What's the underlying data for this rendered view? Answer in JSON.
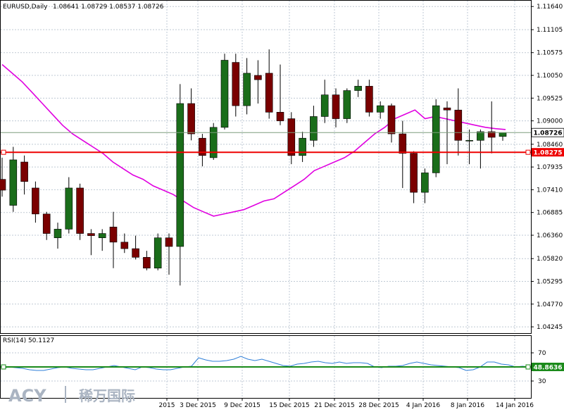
{
  "header": {
    "symbol": "EURUSD,Daily",
    "ohlc": "1.08641 1.08729 1.08537 1.08726"
  },
  "rsi_header": "RSI(14) 50.1127",
  "logo": {
    "latin": "ACY",
    "cn": "稀万国际"
  },
  "colors": {
    "bull": "#1a6d1a",
    "bear": "#7a0000",
    "ma": "#e000e0",
    "hline": "#ee0000",
    "rsi_line": "#2f7fd8",
    "rsi_level": "#1a8a1a",
    "grid": "#bfc9d4"
  },
  "chart_data": [
    {
      "type": "candlestick",
      "ylim": [
        1.041,
        1.1179
      ],
      "y_ticks": [
        "1.11640",
        "1.11105",
        "1.10575",
        "1.10050",
        "1.09525",
        "1.09000",
        "1.08460",
        "1.07935",
        "1.07410",
        "1.06885",
        "1.06360",
        "1.05820",
        "1.05295",
        "1.04770",
        "1.04245"
      ],
      "x_labels": [
        "2015",
        "3 Dec 2015",
        "9 Dec 2015",
        "15 Dec 2015",
        "21 Dec 2015",
        "28 Dec 2015",
        "4 Jan 2016",
        "8 Jan 2016",
        "14 Jan 2016"
      ],
      "price_label": "1.08726",
      "line_label": "1.08275",
      "horizontal_line": 1.08275,
      "candles": [
        {
          "o": 1.0765,
          "h": 1.0815,
          "l": 1.0725,
          "c": 1.074
        },
        {
          "o": 1.0705,
          "h": 1.084,
          "l": 1.069,
          "c": 1.081
        },
        {
          "o": 1.0805,
          "h": 1.082,
          "l": 1.073,
          "c": 1.076
        },
        {
          "o": 1.0745,
          "h": 1.076,
          "l": 1.0665,
          "c": 1.0685
        },
        {
          "o": 1.0685,
          "h": 1.069,
          "l": 1.0625,
          "c": 1.064
        },
        {
          "o": 1.063,
          "h": 1.0665,
          "l": 1.0605,
          "c": 1.065
        },
        {
          "o": 1.065,
          "h": 1.077,
          "l": 1.064,
          "c": 1.0745
        },
        {
          "o": 1.0745,
          "h": 1.0755,
          "l": 1.0625,
          "c": 1.064
        },
        {
          "o": 1.064,
          "h": 1.065,
          "l": 1.059,
          "c": 1.0635
        },
        {
          "o": 1.063,
          "h": 1.065,
          "l": 1.06,
          "c": 1.064
        },
        {
          "o": 1.0655,
          "h": 1.069,
          "l": 1.056,
          "c": 1.062
        },
        {
          "o": 1.062,
          "h": 1.064,
          "l": 1.0595,
          "c": 1.0605
        },
        {
          "o": 1.0605,
          "h": 1.0635,
          "l": 1.058,
          "c": 1.0585
        },
        {
          "o": 1.0585,
          "h": 1.06,
          "l": 1.0555,
          "c": 1.056
        },
        {
          "o": 1.056,
          "h": 1.064,
          "l": 1.0555,
          "c": 1.063
        },
        {
          "o": 1.063,
          "h": 1.064,
          "l": 1.0545,
          "c": 1.061
        },
        {
          "o": 1.061,
          "h": 1.0985,
          "l": 1.052,
          "c": 1.094
        },
        {
          "o": 1.094,
          "h": 1.0975,
          "l": 1.0855,
          "c": 1.087
        },
        {
          "o": 1.086,
          "h": 1.087,
          "l": 1.0795,
          "c": 1.082
        },
        {
          "o": 1.0815,
          "h": 1.0895,
          "l": 1.081,
          "c": 1.0885
        },
        {
          "o": 1.0885,
          "h": 1.1055,
          "l": 1.088,
          "c": 1.104
        },
        {
          "o": 1.1035,
          "h": 1.1055,
          "l": 1.091,
          "c": 1.0935
        },
        {
          "o": 1.0935,
          "h": 1.1045,
          "l": 1.0915,
          "c": 1.101
        },
        {
          "o": 1.1005,
          "h": 1.104,
          "l": 1.094,
          "c": 1.0995
        },
        {
          "o": 1.101,
          "h": 1.1065,
          "l": 1.0905,
          "c": 1.092
        },
        {
          "o": 1.092,
          "h": 1.103,
          "l": 1.089,
          "c": 1.09
        },
        {
          "o": 1.0905,
          "h": 1.092,
          "l": 1.08,
          "c": 1.082
        },
        {
          "o": 1.082,
          "h": 1.0875,
          "l": 1.0805,
          "c": 1.086
        },
        {
          "o": 1.0855,
          "h": 1.0935,
          "l": 1.084,
          "c": 1.091
        },
        {
          "o": 1.091,
          "h": 1.0995,
          "l": 1.0895,
          "c": 1.096
        },
        {
          "o": 1.096,
          "h": 1.0975,
          "l": 1.0885,
          "c": 1.0905
        },
        {
          "o": 1.0905,
          "h": 1.0975,
          "l": 1.0895,
          "c": 1.097
        },
        {
          "o": 1.097,
          "h": 1.0995,
          "l": 1.0955,
          "c": 1.098
        },
        {
          "o": 1.098,
          "h": 1.0995,
          "l": 1.091,
          "c": 1.092
        },
        {
          "o": 1.092,
          "h": 1.0945,
          "l": 1.0905,
          "c": 1.0935
        },
        {
          "o": 1.0935,
          "h": 1.094,
          "l": 1.085,
          "c": 1.087
        },
        {
          "o": 1.087,
          "h": 1.09,
          "l": 1.0745,
          "c": 1.0825
        },
        {
          "o": 1.0825,
          "h": 1.083,
          "l": 1.071,
          "c": 1.0735
        },
        {
          "o": 1.0735,
          "h": 1.079,
          "l": 1.071,
          "c": 1.078
        },
        {
          "o": 1.078,
          "h": 1.095,
          "l": 1.077,
          "c": 1.0935
        },
        {
          "o": 1.093,
          "h": 1.0945,
          "l": 1.08,
          "c": 1.0925
        },
        {
          "o": 1.0925,
          "h": 1.0975,
          "l": 1.082,
          "c": 1.0855
        },
        {
          "o": 1.0855,
          "h": 1.088,
          "l": 1.08,
          "c": 1.0855
        },
        {
          "o": 1.0855,
          "h": 1.088,
          "l": 1.079,
          "c": 1.0875
        },
        {
          "o": 1.0875,
          "h": 1.0945,
          "l": 1.0825,
          "c": 1.0862
        },
        {
          "o": 1.0864,
          "h": 1.0873,
          "l": 1.0854,
          "c": 1.0873
        }
      ],
      "ma": [
        1.103,
        1.101,
        1.099,
        1.0965,
        1.094,
        1.0915,
        1.089,
        1.087,
        1.0855,
        1.084,
        1.0825,
        1.0805,
        1.079,
        1.0775,
        1.0765,
        1.075,
        1.074,
        1.073,
        1.0715,
        1.07,
        1.069,
        1.068,
        1.0685,
        1.069,
        1.0695,
        1.0705,
        1.0715,
        1.072,
        1.0735,
        1.075,
        1.0765,
        1.0785,
        1.0795,
        1.0805,
        1.0815,
        1.083,
        1.085,
        1.087,
        1.0885,
        1.0905,
        1.0915,
        1.0925,
        1.0905,
        1.091,
        1.0905,
        1.09,
        1.0895,
        1.089,
        1.0885,
        1.0882,
        1.088
      ]
    },
    {
      "type": "line",
      "name": "RSI(14)",
      "ylim": [
        30,
        70
      ],
      "y_ticks": [
        "70",
        "30"
      ],
      "level": 50,
      "level_label": "48.8636",
      "values": [
        47,
        50,
        49,
        48,
        46,
        45,
        45,
        47,
        49,
        50,
        48,
        47,
        46,
        46,
        48,
        50,
        52,
        50,
        48,
        46,
        50,
        49,
        47,
        46,
        46,
        48,
        50,
        51,
        63,
        60,
        58,
        58,
        59,
        61,
        65,
        61,
        59,
        61,
        58,
        55,
        52,
        51,
        54,
        55,
        57,
        58,
        56,
        55,
        57,
        55,
        56,
        56,
        55,
        50,
        49,
        51,
        51,
        52,
        55,
        57,
        55,
        53,
        52,
        51,
        50,
        49,
        45,
        46,
        50,
        57,
        57,
        54,
        53,
        50,
        51,
        50
      ]
    }
  ]
}
